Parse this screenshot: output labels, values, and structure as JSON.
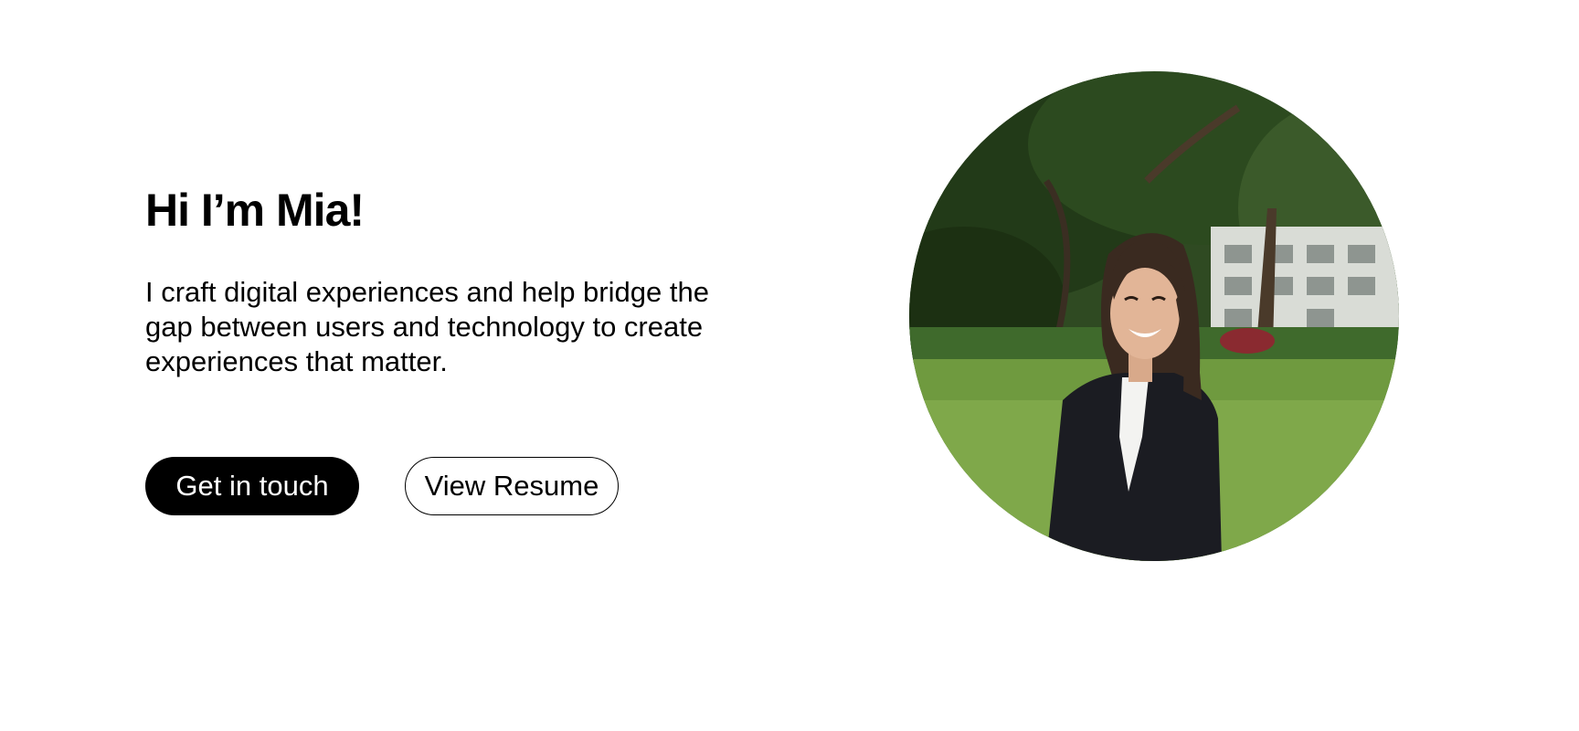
{
  "hero": {
    "title": "Hi I’m Mia!",
    "description": "I craft digital experiences and help bridge the gap between users and technology to create experiences that matter.",
    "primary_button": "Get in touch",
    "secondary_button": "View Resume"
  },
  "portrait": {
    "subject": "smiling person in dark blazer outdoors on lawn with trees and building"
  },
  "colors": {
    "background": "#ffffff",
    "text": "#000000",
    "primary_button_bg": "#000000",
    "primary_button_text": "#ffffff"
  }
}
